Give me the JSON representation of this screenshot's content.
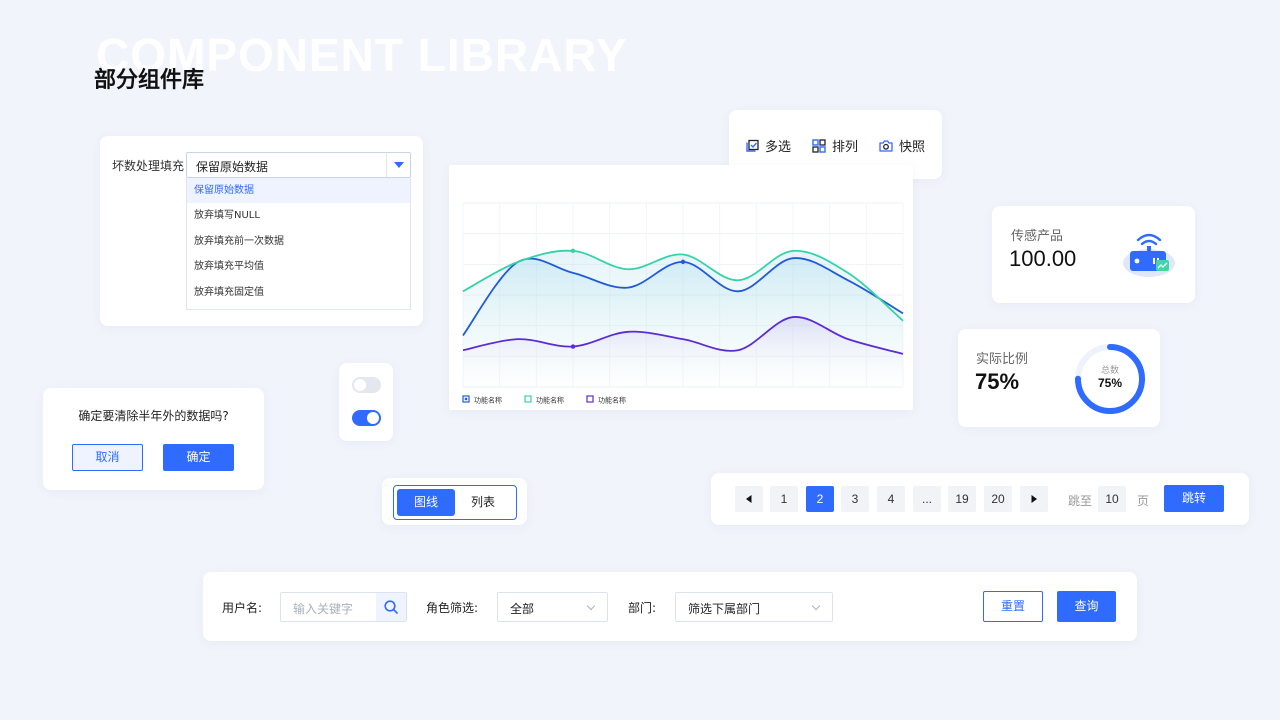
{
  "watermark": "COMPONENT LIBRARY",
  "page_title": "部分组件库",
  "dropdown": {
    "label": "坏数处理填充",
    "selected": "保留原始数据",
    "options": [
      "保留原始数据",
      "放弃填写NULL",
      "放弃填充前一次数据",
      "放弃填充平均值",
      "放弃填充固定值"
    ]
  },
  "dialog": {
    "message": "确定要清除半年外的数据吗?",
    "cancel_label": "取消",
    "confirm_label": "确定"
  },
  "toggles": {
    "first_on": false,
    "second_on": true
  },
  "segmented": {
    "options": [
      "图线",
      "列表"
    ],
    "active_index": 0
  },
  "toolbar": {
    "items": [
      {
        "label": "多选",
        "icon": "multi-select-icon"
      },
      {
        "label": "排列",
        "icon": "grid-icon"
      },
      {
        "label": "快照",
        "icon": "camera-icon"
      }
    ]
  },
  "chart_data": {
    "type": "area",
    "x": [
      0,
      1,
      2,
      3,
      4,
      5,
      6,
      7,
      8
    ],
    "ylim": [
      0,
      100
    ],
    "series": [
      {
        "name": "功能名称",
        "color": "#1f5bd9",
        "values": [
          28,
          68,
          62,
          54,
          68,
          52,
          70,
          58,
          40
        ]
      },
      {
        "name": "功能名称",
        "color": "#34d3a6",
        "values": [
          52,
          68,
          74,
          64,
          72,
          58,
          74,
          62,
          36
        ]
      },
      {
        "name": "功能名称",
        "color": "#5b2bd6",
        "values": [
          20,
          26,
          22,
          30,
          26,
          20,
          38,
          26,
          18
        ]
      }
    ],
    "legend": "bottom-left",
    "grid": true
  },
  "sensor": {
    "label": "传感产品",
    "value": "100.00"
  },
  "ratio": {
    "label": "实际比例",
    "value": "75%",
    "ring_label": "总数",
    "ring_value": "75%",
    "fraction": 0.75
  },
  "pagination": {
    "pages": [
      "1",
      "2",
      "3",
      "4",
      "...",
      "19",
      "20"
    ],
    "active": "2",
    "jump_prefix": "跳至",
    "jump_value": "10",
    "jump_suffix": "页",
    "jump_button": "跳转"
  },
  "filters": {
    "username_label": "用户名:",
    "username_placeholder": "输入关键字",
    "role_label": "角色筛选:",
    "role_value": "全部",
    "dept_label": "部门:",
    "dept_value": "筛选下属部门",
    "reset_label": "重置",
    "query_label": "查询"
  },
  "colors": {
    "accent": "#2f6bff",
    "background": "#f1f4fb"
  }
}
